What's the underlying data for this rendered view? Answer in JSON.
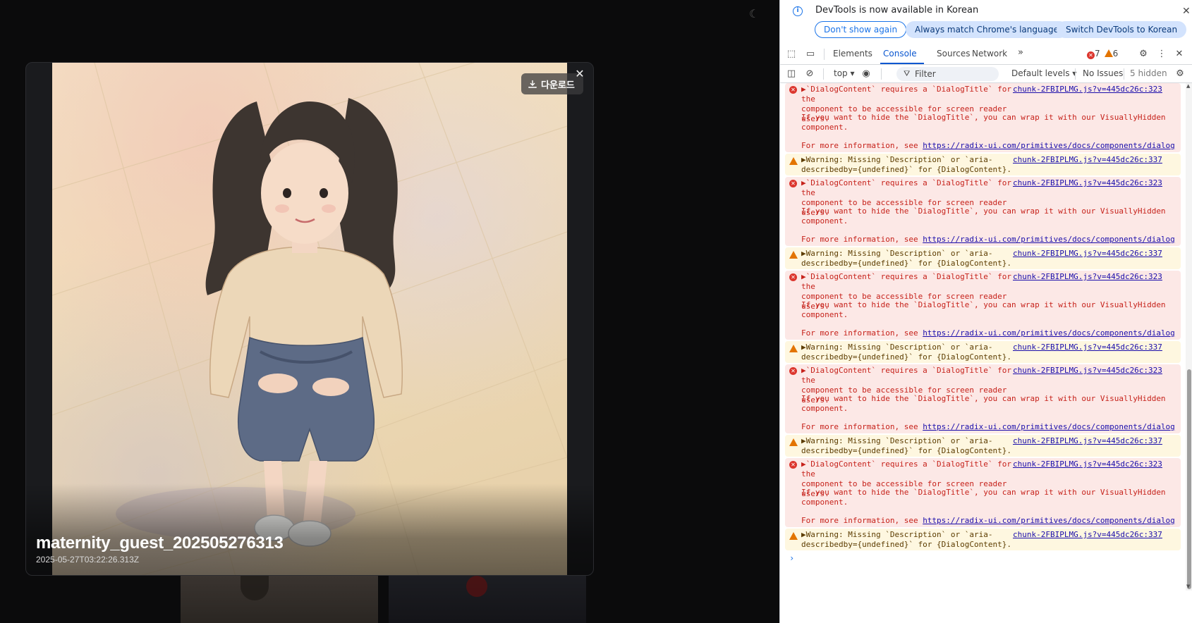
{
  "page": {
    "theme_toggle_icon": "moon-icon"
  },
  "modal": {
    "title": "maternity_guest_202505276313",
    "date": "2025-05-27T03:22:26.313Z",
    "download_label": "다운로드",
    "close_icon": "close-icon",
    "download_icon": "download-icon"
  },
  "devtools": {
    "infobar": {
      "message": "DevTools is now available in Korean",
      "btn_dont_show": "Don't show again",
      "btn_always_match": "Always match Chrome's language",
      "btn_switch": "Switch DevTools to Korean"
    },
    "tabs": [
      "Elements",
      "Console",
      "Sources",
      "Network"
    ],
    "active_tab": "Console",
    "error_count": "7",
    "warning_count": "6",
    "toolbar": {
      "context": "top",
      "filter_placeholder": "Filter",
      "levels": "Default levels",
      "issues": "No Issues",
      "hidden": "5 hidden"
    },
    "colors": {
      "error_bg": "#fce8e6",
      "warning_bg": "#fef7e0",
      "accent": "#0b57d0"
    }
  },
  "console": {
    "error": {
      "line1": "▶`DialogContent` requires a `DialogTitle` for the",
      "line2": "component to be accessible for screen reader users.",
      "line3": "If you want to hide the `DialogTitle`, you can wrap it with our VisuallyHidden",
      "line4": "component.",
      "more_prefix": "For more information, see ",
      "link": "https://radix-ui.com/primitives/docs/components/dialog",
      "source": "chunk-2FBIPLMG.js?v=445dc26c:323"
    },
    "warning": {
      "line1": "▶Warning: Missing `Description` or `aria-",
      "line2": "describedby={undefined}` for {DialogContent}.",
      "source": "chunk-2FBIPLMG.js?v=445dc26c:337"
    },
    "prompt": "›"
  }
}
